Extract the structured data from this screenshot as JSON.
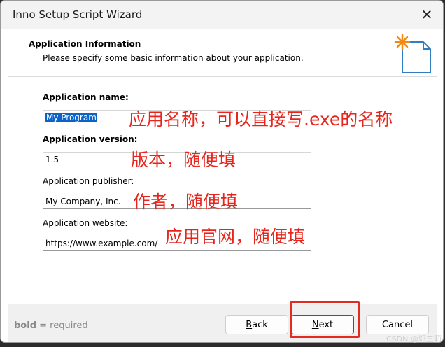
{
  "window": {
    "title": "Inno Setup Script Wizard",
    "close_glyph": "✕"
  },
  "header": {
    "title": "Application Information",
    "subtitle": "Please specify some basic information about your application."
  },
  "fields": {
    "name": {
      "label_pre": "Application na",
      "label_acc": "m",
      "label_post": "e:",
      "value": "My Program"
    },
    "version": {
      "label_pre": "Application ",
      "label_acc": "v",
      "label_post": "ersion:",
      "value": "1.5"
    },
    "publisher": {
      "label_pre": "Application p",
      "label_acc": "u",
      "label_post": "blisher:",
      "value": "My Company, Inc."
    },
    "website": {
      "label_pre": "Application ",
      "label_acc": "w",
      "label_post": "ebsite:",
      "value": "https://www.example.com/"
    }
  },
  "annotations": {
    "name": "应用名称，可以直接写.exe的名称",
    "version": "版本，随便填",
    "publisher": "作者，随便填",
    "website": "应用官网，随便填"
  },
  "footer": {
    "bold_word": "bold",
    "note_rest": " = required",
    "back_acc": "B",
    "back_rest": "ack",
    "next_acc": "N",
    "next_rest": "ext",
    "cancel": "Cancel"
  },
  "watermark": "CSDN @邓三莉",
  "colors": {
    "annotation": "#e8251c",
    "selection": "#0a64c8",
    "highlight_box": "#e52b20"
  }
}
